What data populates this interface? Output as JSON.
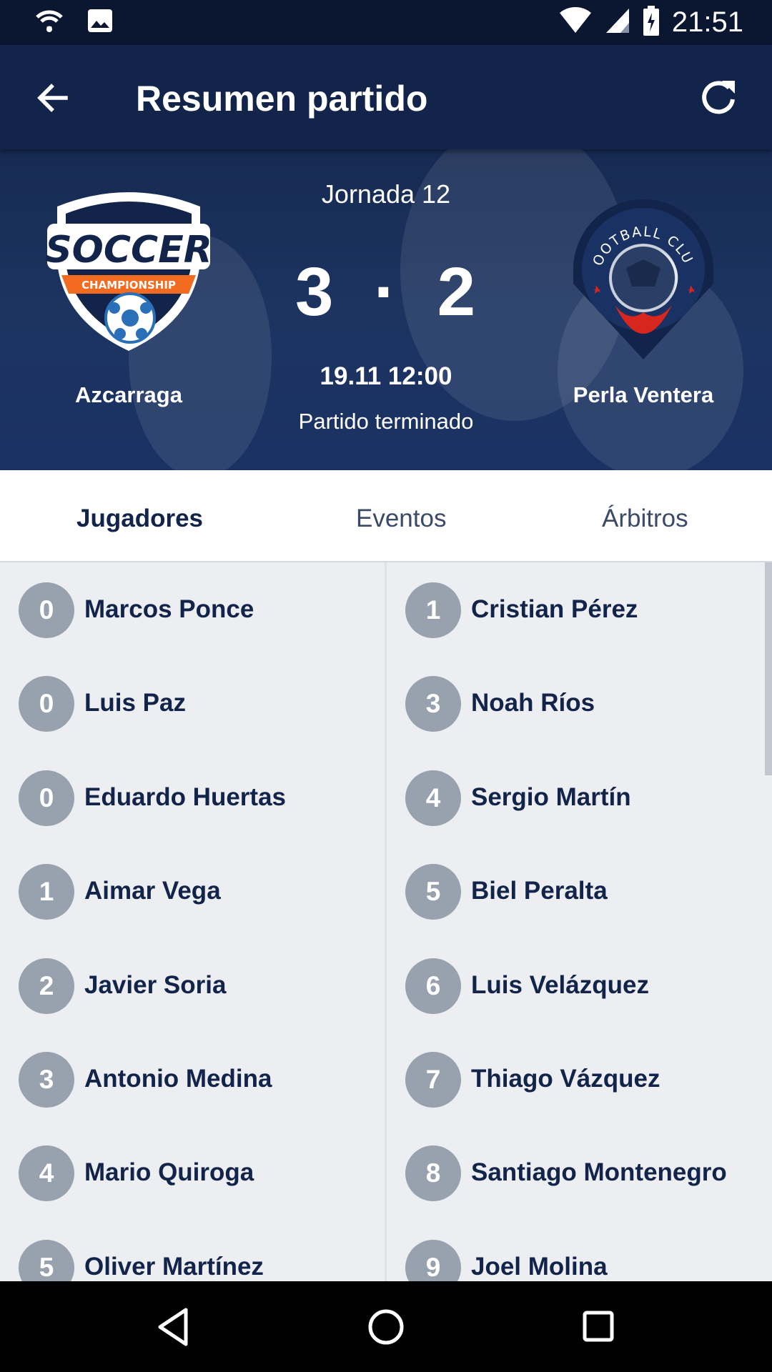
{
  "status_bar": {
    "time": "21:51"
  },
  "app_bar": {
    "title": "Resumen partido"
  },
  "match": {
    "round": "Jornada 12",
    "home_team": "Azcarraga",
    "away_team": "Perla Ventera",
    "home_score": "3",
    "separator": "·",
    "away_score": "2",
    "datetime": "19.11 12:00",
    "status": "Partido terminado",
    "home_logo": {
      "text_main": "SOCCER",
      "text_ribbon": "CHAMPIONSHIP"
    },
    "away_logo": {
      "text_arc": "FOOTBALL CLUB"
    }
  },
  "tabs": [
    {
      "label": "Jugadores",
      "active": true
    },
    {
      "label": "Eventos",
      "active": false
    },
    {
      "label": "Árbitros",
      "active": false
    }
  ],
  "players_home": [
    {
      "number": "0",
      "name": "Marcos Ponce"
    },
    {
      "number": "0",
      "name": "Luis Paz"
    },
    {
      "number": "0",
      "name": "Eduardo Huertas"
    },
    {
      "number": "1",
      "name": "Aimar Vega"
    },
    {
      "number": "2",
      "name": "Javier Soria"
    },
    {
      "number": "3",
      "name": "Antonio Medina"
    },
    {
      "number": "4",
      "name": "Mario Quiroga"
    },
    {
      "number": "5",
      "name": "Oliver Martínez"
    }
  ],
  "players_away": [
    {
      "number": "1",
      "name": "Cristian Pérez"
    },
    {
      "number": "3",
      "name": "Noah Ríos"
    },
    {
      "number": "4",
      "name": "Sergio Martín"
    },
    {
      "number": "5",
      "name": "Biel Peralta"
    },
    {
      "number": "6",
      "name": "Luis Velázquez"
    },
    {
      "number": "7",
      "name": "Thiago Vázquez"
    },
    {
      "number": "8",
      "name": "Santiago Montenegro"
    },
    {
      "number": "9",
      "name": "Joel Molina"
    }
  ],
  "colors": {
    "primary": "#13244a",
    "header_bg": "#1d3461",
    "badge": "#98a1ae",
    "list_bg": "#eceef2",
    "accent_orange": "#f26b21",
    "accent_red": "#d7261e"
  }
}
